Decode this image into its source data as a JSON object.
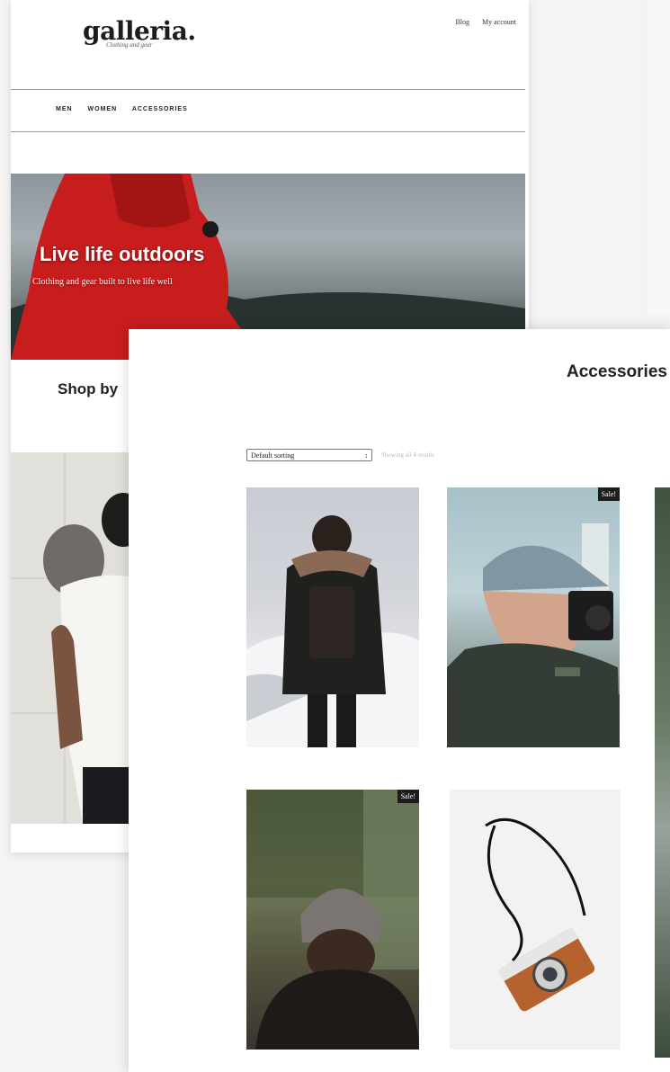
{
  "site": {
    "logo": "galleria.",
    "tagline": "Clothing and gear",
    "top_links": [
      "Blog",
      "My account"
    ],
    "nav": [
      "MEN",
      "WOMEN",
      "ACCESSORIES"
    ]
  },
  "hero": {
    "title": "Live life outdoors",
    "subtitle": "Clothing and gear built to live life well"
  },
  "shop_by": "Shop by",
  "accessories": {
    "title": "Accessories",
    "sort_label": "Default sorting",
    "results_text": "Showing all 4 results",
    "sale_badge": "Sale!"
  },
  "colors": {
    "hero_jacket": "#c81d1d",
    "sale_badge_bg": "#1d1d1d",
    "camera_leather": "#b6622f"
  }
}
